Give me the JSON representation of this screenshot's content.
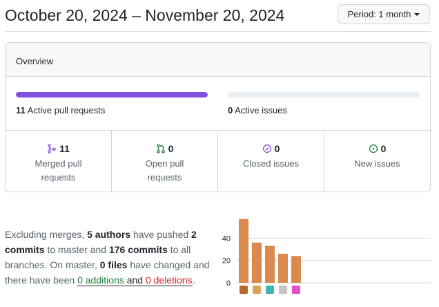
{
  "header": {
    "title": "October 20, 2024 – November 20, 2024",
    "period_label": "Period: 1 month"
  },
  "overview": {
    "title": "Overview",
    "pull_requests_bar": {
      "count": "11",
      "label": "Active pull requests",
      "fill_fraction": 1.0,
      "color": "#8250df"
    },
    "issues_bar": {
      "count": "0",
      "label": "Active issues",
      "fill_fraction": 0.0,
      "color": "#1a7f37"
    },
    "stats": [
      {
        "icon": "merged-pr-icon",
        "count": "11",
        "label": "Merged pull requests",
        "color": "#8250df"
      },
      {
        "icon": "open-pr-icon",
        "count": "0",
        "label": "Open pull requests",
        "color": "#1a7f37"
      },
      {
        "icon": "closed-issue-icon",
        "count": "0",
        "label": "Closed issues",
        "color": "#8250df"
      },
      {
        "icon": "new-issue-icon",
        "count": "0",
        "label": "New issues",
        "color": "#1a7f37"
      }
    ]
  },
  "summary": {
    "t1": "Excluding merges, ",
    "authors": "5 authors",
    "t2": " have pushed ",
    "commits_master": "2 commits",
    "t3": " to master and ",
    "commits_all": "176 commits",
    "t4": " to all branches. On master, ",
    "files": "0 files",
    "t5": " have changed and there have been ",
    "additions": "0 additions",
    "t6": " and ",
    "deletions": "0 deletions",
    "t7": "."
  },
  "chart_data": {
    "type": "bar",
    "categories": [
      "contributor-1",
      "contributor-2",
      "contributor-3",
      "contributor-4",
      "contributor-5"
    ],
    "values": [
      57,
      36,
      33,
      26,
      24
    ],
    "yticks": [
      "0",
      "20",
      "40"
    ],
    "ylim": [
      0,
      60
    ],
    "grid": true,
    "bar_color": "#db8a4f",
    "avatar_colors": [
      "#b86a2e",
      "#d9a25a",
      "#3fb5b0",
      "#c4c4c4",
      "#e050c8"
    ]
  }
}
